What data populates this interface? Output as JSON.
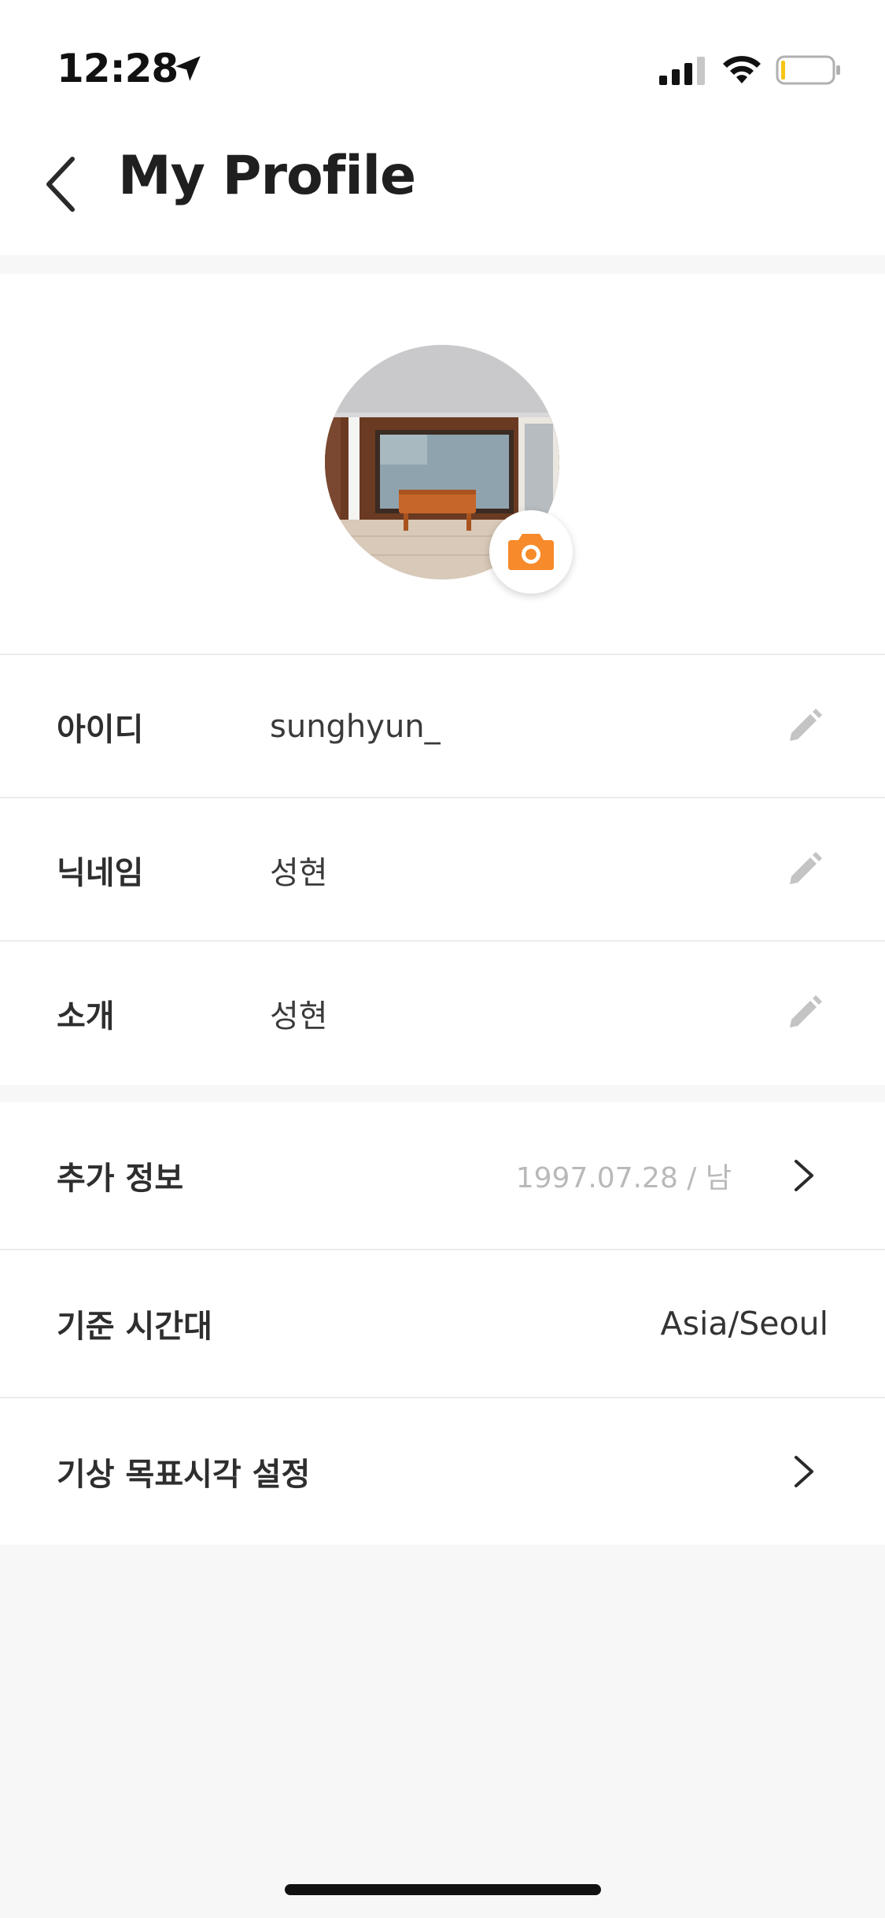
{
  "status_bar": {
    "time": "12:28",
    "location_icon": "location-arrow-icon",
    "signal_icon": "cellular-signal-icon",
    "wifi_icon": "wifi-icon",
    "battery_icon": "battery-icon"
  },
  "header": {
    "back_icon": "chevron-left-icon",
    "title": "My Profile"
  },
  "profile": {
    "avatar": "profile-photo",
    "camera_icon": "camera-icon",
    "accent_color": "#f78a2a"
  },
  "info": {
    "rows": [
      {
        "label": "아이디",
        "value": "sunghyun_",
        "icon": "pencil-icon"
      },
      {
        "label": "닉네임",
        "value": "성현",
        "icon": "pencil-icon"
      },
      {
        "label": "소개",
        "value": "성현",
        "icon": "pencil-icon"
      }
    ]
  },
  "settings": {
    "extra_info": {
      "label": "추가 정보",
      "value": "1997.07.28 / 남",
      "icon": "chevron-right-icon"
    },
    "timezone": {
      "label": "기준 시간대",
      "value": "Asia/Seoul"
    },
    "wake_goal": {
      "label": "기상 목표시각 설정",
      "icon": "chevron-right-icon"
    }
  }
}
